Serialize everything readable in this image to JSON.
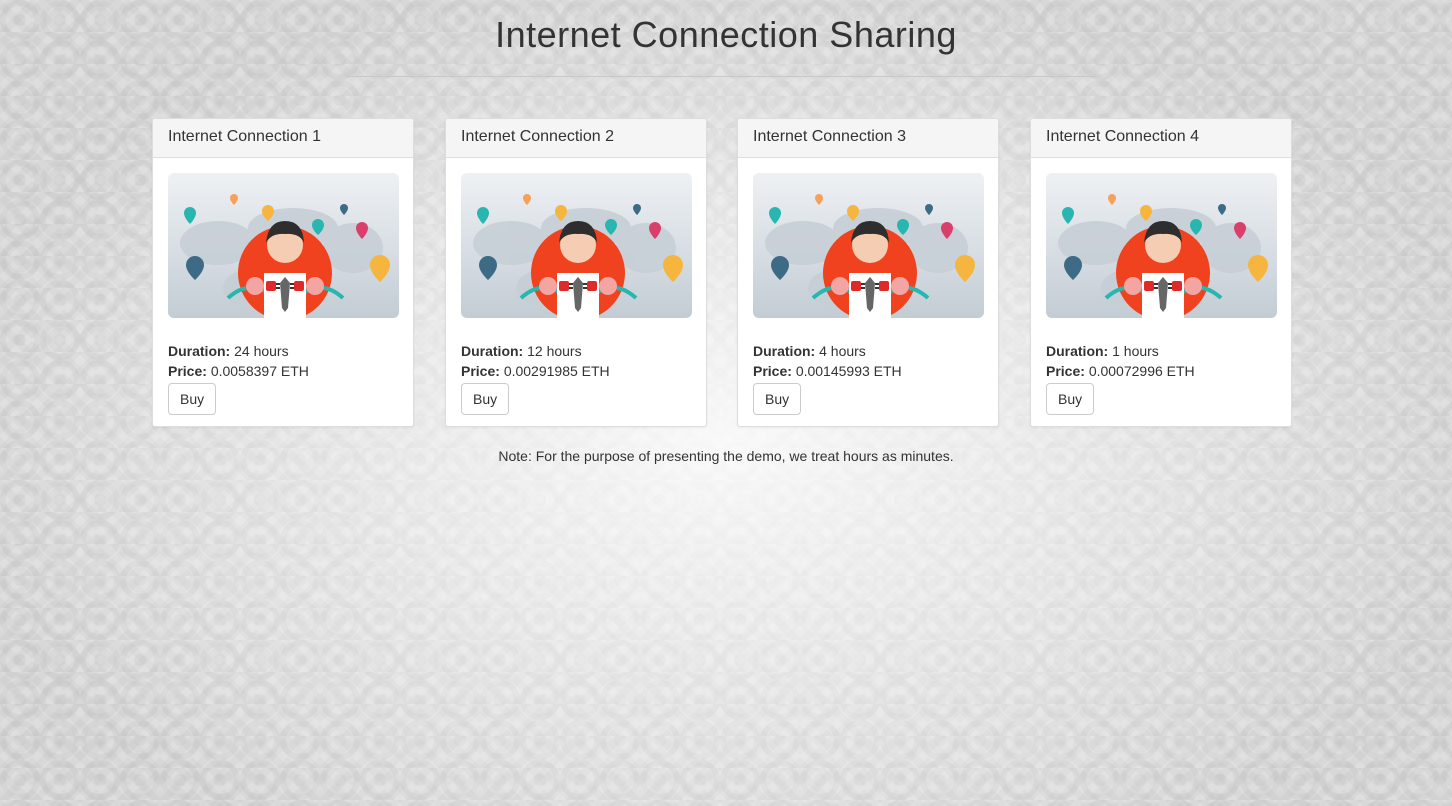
{
  "page": {
    "title": "Internet Connection Sharing",
    "note": "Note: For the purpose of presenting the demo, we treat hours as minutes."
  },
  "labels": {
    "duration": "Duration:",
    "price": "Price:",
    "buy": "Buy"
  },
  "connections": [
    {
      "title": "Internet Connection 1",
      "duration": "24 hours",
      "price": "0.0058397 ETH"
    },
    {
      "title": "Internet Connection 2",
      "duration": "12 hours",
      "price": "0.00291985 ETH"
    },
    {
      "title": "Internet Connection 3",
      "duration": "4 hours",
      "price": "0.00145993 ETH"
    },
    {
      "title": "Internet Connection 4",
      "duration": "1 hours",
      "price": "0.00072996 ETH"
    }
  ],
  "icons": {
    "illustration": "man-holding-plug-over-world-map-illustration"
  },
  "colors": {
    "accent_red": "#f0421e",
    "pin_teal": "#29b6b0",
    "pin_navy": "#3d6b85",
    "pin_pink": "#d93f6b",
    "pin_yellow": "#f6b53e"
  }
}
